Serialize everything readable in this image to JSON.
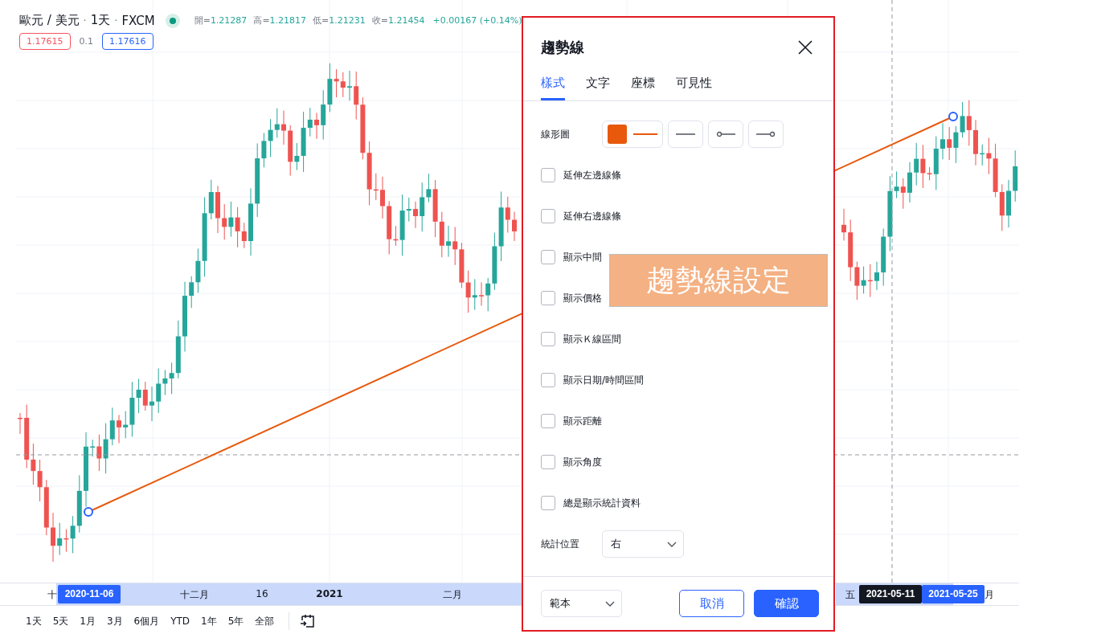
{
  "header": {
    "title_parts": [
      "歐元 / 美元",
      "·",
      "1天",
      "·",
      "FXCM"
    ],
    "market_open": true,
    "ohlc": [
      {
        "label": "開=",
        "value": "1.21287"
      },
      {
        "label": "高=",
        "value": "1.21817"
      },
      {
        "label": "低=",
        "value": "1.21231"
      },
      {
        "label": "收=",
        "value": "1.21454"
      }
    ],
    "change": "+0.00167 (+0.14%)"
  },
  "prices": {
    "bid": "1.17615",
    "spread": "0.1",
    "ask": "1.17616"
  },
  "time_axis": {
    "labels": [
      {
        "text": "十",
        "bold": false
      },
      {
        "text": "十二月",
        "bold": false
      },
      {
        "text": "16",
        "bold": false
      },
      {
        "text": "2021",
        "bold": true
      },
      {
        "text": "二月",
        "bold": false
      },
      {
        "text": "五",
        "bold": false
      },
      {
        "text": "月",
        "bold": false
      }
    ],
    "markers": [
      {
        "text": "2020-11-06",
        "kind": "handle"
      },
      {
        "text": "2021-05-11",
        "kind": "crosshair"
      },
      {
        "text": "2021-05-25",
        "kind": "handle"
      }
    ]
  },
  "range_buttons": [
    "1天",
    "5天",
    "1月",
    "3月",
    "6個月",
    "YTD",
    "1年",
    "5年",
    "全部"
  ],
  "dialog": {
    "title": "趨勢線",
    "tabs": [
      {
        "label": "樣式",
        "selected": true
      },
      {
        "label": "文字",
        "selected": false
      },
      {
        "label": "座標",
        "selected": false
      },
      {
        "label": "可見性",
        "selected": false
      }
    ],
    "line_style": {
      "label": "線形圖",
      "color": "#e8590c"
    },
    "options": [
      {
        "label": "延伸左邊線條",
        "checked": false
      },
      {
        "label": "延伸右邊線條",
        "checked": false
      },
      {
        "label": "顯示中間",
        "checked": false
      },
      {
        "label": "顯示價格",
        "checked": false
      },
      {
        "label": "顯示Ｋ線區間",
        "checked": false
      },
      {
        "label": "顯示日期/時間區間",
        "checked": false
      },
      {
        "label": "顯示距離",
        "checked": false
      },
      {
        "label": "顯示角度",
        "checked": false
      },
      {
        "label": "總是顯示統計資料",
        "checked": false
      }
    ],
    "stats_position": {
      "label": "統計位置",
      "value": "右"
    },
    "template": "範本",
    "cancel": "取消",
    "ok": "確認"
  },
  "annotation": "趨勢線設定"
}
